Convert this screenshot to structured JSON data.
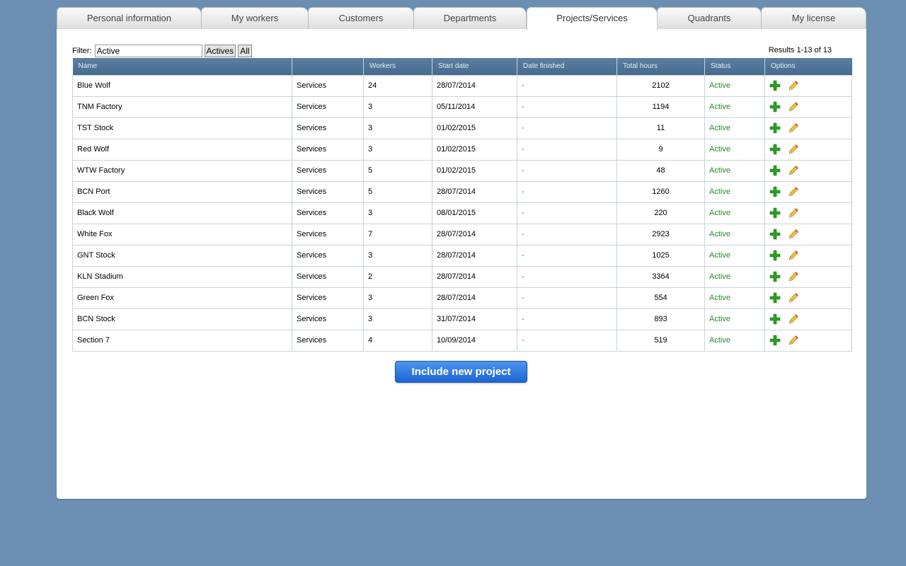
{
  "tabs": [
    {
      "label": "Personal information"
    },
    {
      "label": "My workers"
    },
    {
      "label": "Customers"
    },
    {
      "label": "Departments"
    },
    {
      "label": "Projects/Services"
    },
    {
      "label": "Quadrants"
    },
    {
      "label": "My license"
    }
  ],
  "active_tab": "Projects/Services",
  "filter": {
    "label": "Filter:",
    "value": "Active",
    "actives_button": "Actives",
    "all_button": "All"
  },
  "results_text": "Results 1-13 of 13",
  "table": {
    "headers": [
      "Name",
      "",
      "Workers",
      "Start date",
      "Date finished",
      "Total hours",
      "Status",
      "Options"
    ],
    "rows": [
      {
        "name": "Blue Wolf",
        "type": "Services",
        "workers": "24",
        "start": "28/07/2014",
        "finished": "-",
        "hours": "2102",
        "status": "Active"
      },
      {
        "name": "TNM Factory",
        "type": "Services",
        "workers": "3",
        "start": "05/11/2014",
        "finished": "-",
        "hours": "1194",
        "status": "Active"
      },
      {
        "name": "TST Stock",
        "type": "Services",
        "workers": "3",
        "start": "01/02/2015",
        "finished": "-",
        "hours": "11",
        "status": "Active"
      },
      {
        "name": "Red Wolf",
        "type": "Services",
        "workers": "3",
        "start": "01/02/2015",
        "finished": "-",
        "hours": "9",
        "status": "Active"
      },
      {
        "name": "WTW Factory",
        "type": "Services",
        "workers": "5",
        "start": "01/02/2015",
        "finished": "-",
        "hours": "48",
        "status": "Active"
      },
      {
        "name": "BCN Port",
        "type": "Services",
        "workers": "5",
        "start": "28/07/2014",
        "finished": "-",
        "hours": "1260",
        "status": "Active"
      },
      {
        "name": "Black Wolf",
        "type": "Services",
        "workers": "3",
        "start": "08/01/2015",
        "finished": "-",
        "hours": "220",
        "status": "Active"
      },
      {
        "name": "White Fox",
        "type": "Services",
        "workers": "7",
        "start": "28/07/2014",
        "finished": "-",
        "hours": "2923",
        "status": "Active"
      },
      {
        "name": "GNT Stock",
        "type": "Services",
        "workers": "3",
        "start": "28/07/2014",
        "finished": "-",
        "hours": "1025",
        "status": "Active"
      },
      {
        "name": "KLN Stadium",
        "type": "Services",
        "workers": "2",
        "start": "28/07/2014",
        "finished": "-",
        "hours": "3364",
        "status": "Active"
      },
      {
        "name": "Green Fox",
        "type": "Services",
        "workers": "3",
        "start": "28/07/2014",
        "finished": "-",
        "hours": "554",
        "status": "Active"
      },
      {
        "name": "BCN Stock",
        "type": "Services",
        "workers": "3",
        "start": "31/07/2014",
        "finished": "-",
        "hours": "893",
        "status": "Active"
      },
      {
        "name": "Section 7",
        "type": "Services",
        "workers": "4",
        "start": "10/09/2014",
        "finished": "-",
        "hours": "519",
        "status": "Active"
      }
    ],
    "row_icons": [
      "add-icon",
      "pencil-icon"
    ]
  },
  "include_button": "Include new project",
  "colors": {
    "background": "#6a8fb2",
    "header": "#4f7498",
    "status_active": "#2a8a2a",
    "finished_dash": "#c0392b",
    "primary_button": "#2a72dc"
  }
}
